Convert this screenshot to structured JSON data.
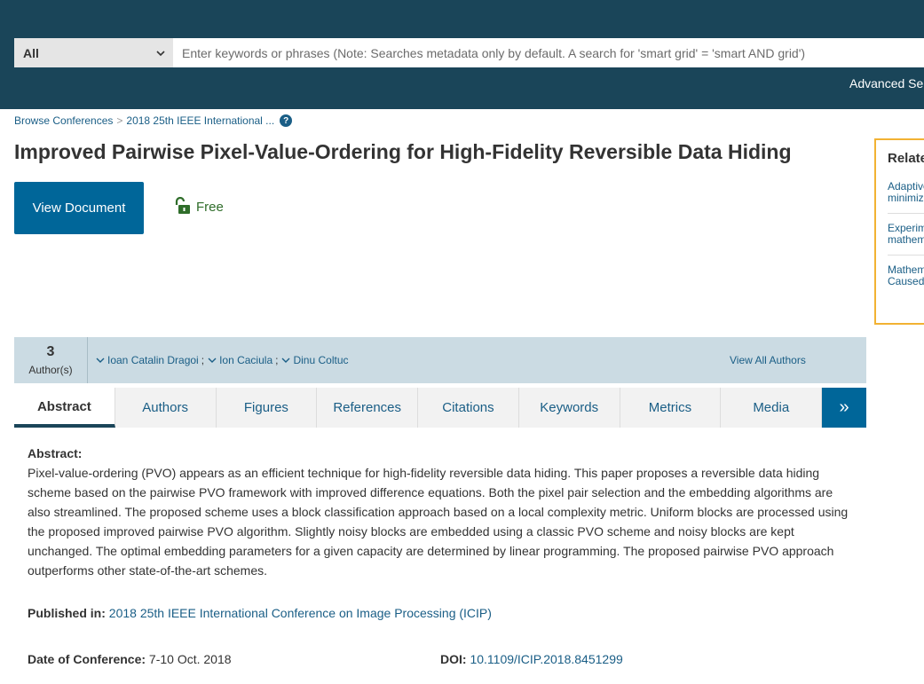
{
  "search": {
    "scope": "All",
    "placeholder": "Enter keywords or phrases (Note: Searches metadata only by default. A search for 'smart grid' = 'smart AND grid')",
    "advanced_label": "Advanced Se"
  },
  "breadcrumb": {
    "item1": "Browse Conferences",
    "separator": ">",
    "item2": "2018 25th IEEE International ...",
    "help_glyph": "?"
  },
  "title": "Improved Pairwise Pixel-Value-Ordering for High-Fidelity Reversible Data Hiding",
  "actions": {
    "view_document": "View Document",
    "access": "Free"
  },
  "related": {
    "title": "Relate",
    "items": [
      {
        "line1": "Adaptive",
        "line2": "minimiz"
      },
      {
        "line1": "Experim",
        "line2": "mathem"
      },
      {
        "line1": "Mathem",
        "line2": "Caused"
      }
    ]
  },
  "authors": {
    "count": "3",
    "count_label": "Author(s)",
    "names": [
      "Ioan Catalin Dragoi",
      "Ion Caciula",
      "Dinu Coltuc"
    ],
    "separator": ";",
    "view_all": "View All Authors"
  },
  "tabs": {
    "items": [
      "Abstract",
      "Authors",
      "Figures",
      "References",
      "Citations",
      "Keywords",
      "Metrics",
      "Media"
    ],
    "more": "»"
  },
  "abstract": {
    "heading": "Abstract:",
    "text": "Pixel-value-ordering (PVO) appears as an efficient technique for high-fidelity reversible data hiding. This paper proposes a reversible data hiding scheme based on the pairwise PVO framework with improved difference equations. Both the pixel pair selection and the embedding algorithms are also streamlined. The proposed scheme uses a block classification approach based on a local complexity metric. Uniform blocks are processed using the proposed improved pairwise PVO algorithm. Slightly noisy blocks are embedded using a classic PVO scheme and noisy blocks are kept unchanged. The optimal embedding parameters for a given capacity are determined by linear programming. The proposed pairwise PVO approach outperforms other state-of-the-art schemes."
  },
  "meta": {
    "published_label": "Published in:",
    "published_value": "2018 25th IEEE International Conference on Image Processing (ICIP)",
    "date_label": "Date of Conference:",
    "date_value": "7-10 Oct. 2018",
    "doi_label": "DOI:",
    "doi_value": "10.1109/ICIP.2018.8451299"
  },
  "colors": {
    "header_bg": "#1a4559",
    "link": "#1a5e86",
    "primary_button": "#006699",
    "free_green": "#2f6d2a",
    "related_border": "#f2b233",
    "authors_bar": "#cbdbe3"
  }
}
